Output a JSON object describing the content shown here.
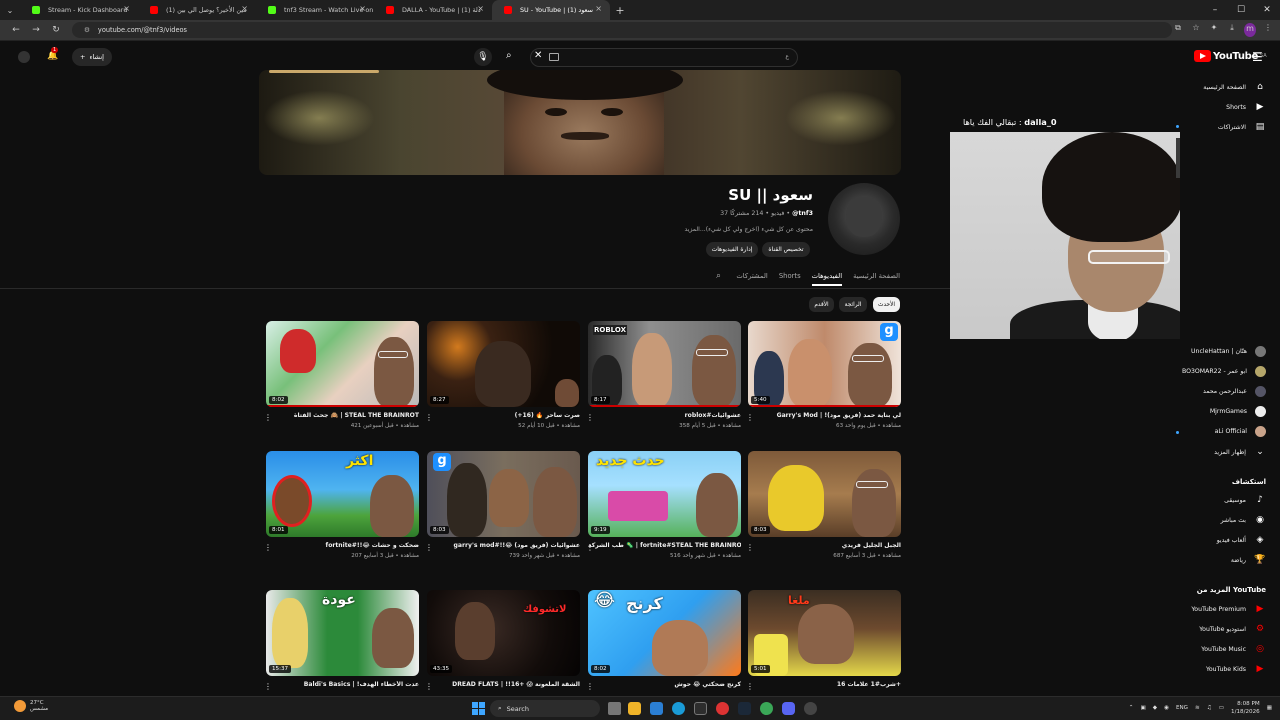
{
  "browser": {
    "tabs": [
      {
        "title": "Stream - Kick Dashboard",
        "favicon_color": "#53fc18",
        "active": false
      },
      {
        "title": "(1) مين الأخير؟ يوصل الي بين",
        "favicon_color": "#ff0000",
        "active": false
      },
      {
        "title": "tnf3 Stream - Watch Live on K",
        "favicon_color": "#53fc18",
        "active": false
      },
      {
        "title": "DALLA - YouTube | دلة (1)",
        "favicon_color": "#ff0000",
        "active": false
      },
      {
        "title": "SU - YouTube | سعود (1)",
        "favicon_color": "#ff0000",
        "active": true
      }
    ],
    "url": "youtube.com/@tnf3/videos"
  },
  "header": {
    "logo_text": "YouTube",
    "logo_region": "SA",
    "create_label": "إنشاء",
    "notification_count": "1",
    "search_lang": "ع"
  },
  "channel": {
    "name": "SU || سعود",
    "handle": "@tnf3",
    "subscribers": "214 مشتركًا",
    "videos_count": "37 فيديو",
    "description": "محتوى عن كل شيء (اخرج ولي كل شيء)...المزيد",
    "btn_customize": "تخصيص القناة",
    "btn_manage": "إدارة الفيديوهات",
    "tabs": [
      "الصفحة الرئيسية",
      "الفيديوهات",
      "Shorts",
      "المشتركات"
    ],
    "active_tab": "الفيديوهات",
    "chips": [
      "الأحدث",
      "الرائجة",
      "الأقدم"
    ]
  },
  "videos": [
    {
      "title": "جحث الفتاة 🙈 | STEAL THE BRAINROT",
      "meta": "421 مشاهدة • قبل أسبوعين",
      "duration": "8:02"
    },
    {
      "title": "صرت ساحر 🔥 (16+)",
      "meta": "52 مشاهدة • قبل 10 أيام",
      "duration": "8:27"
    },
    {
      "title": "roblox#عشوائيات",
      "meta": "358 مشاهدة • قبل 5 أيام",
      "duration": "8:17"
    },
    {
      "title": "Garry's Mod | !(فريق مود) لي بناية حمد",
      "meta": "63 مشاهدة • قبل يوم واحد",
      "duration": "5:40"
    },
    {
      "title": "fortnite#!!😂 ضحكت و حشات",
      "meta": "207 مشاهدة • قبل 3 أسابيع",
      "duration": "8:01"
    },
    {
      "title": "garry's mod#!!😂 (فريق مود) عشوائيات",
      "meta": "739 مشاهدة • قبل شهر واحد",
      "duration": "8:03"
    },
    {
      "title": "طب الشركة 🦠 | fortnite#STEAL THE BRAINROT",
      "meta": "516 مشاهدة • قبل شهر واحد",
      "duration": "9:19"
    },
    {
      "title": "الجبل الجليل فريدي",
      "meta": "687 مشاهدة • قبل 3 أسابيع",
      "duration": "8:03"
    },
    {
      "title": "Baldi's Basics | !عدت الأخطاء الهدف",
      "meta": "",
      "duration": "15:37"
    },
    {
      "title": "DREAD FLATS | !!16+ 😱 الشقة الملعونة",
      "meta": "",
      "duration": "43:35"
    },
    {
      "title": "كرنج ضحكتي 😂 حوش",
      "meta": "",
      "duration": "8:02"
    },
    {
      "title": "شرب#1 علامات 16+",
      "meta": "",
      "duration": "5:01"
    }
  ],
  "sidebar": {
    "main": [
      {
        "label": "الصفحة الرئيسية",
        "icon": "home-icon"
      },
      {
        "label": "Shorts",
        "icon": "shorts-icon"
      },
      {
        "label": "الاشتراكات",
        "icon": "subscriptions-icon"
      }
    ],
    "subs": [
      {
        "label": "UncleHattan | هتّان",
        "color": "#777"
      },
      {
        "label": "BO3OMAR22 - ابو عمر",
        "color": "#b5a66a"
      },
      {
        "label": "عبدالرحمن محمد",
        "color": "#556"
      },
      {
        "label": "MjrmGames",
        "color": "#eee"
      },
      {
        "label": "aLi Official",
        "color": "#c9a38a"
      }
    ],
    "show_more": "إظهار المزيد",
    "explore_title": "استكشاف",
    "explore": [
      {
        "label": "موسيقى",
        "icon": "music-icon"
      },
      {
        "label": "بث مباشر",
        "icon": "live-icon"
      },
      {
        "label": "ألعاب فيديو",
        "icon": "gaming-icon"
      },
      {
        "label": "رياضة",
        "icon": "trophy-icon"
      }
    ],
    "more_title": "المزيد من YouTube",
    "more": [
      {
        "label": "YouTube Premium"
      },
      {
        "label": "YouTube استوديو"
      },
      {
        "label": "YouTube Music"
      },
      {
        "label": "YouTube Kids"
      }
    ]
  },
  "webcam": {
    "caption_user": "dalla_0",
    "caption_text": "تبقالي الفك ياها :"
  },
  "taskbar": {
    "weather_temp": "27°C",
    "weather_desc": "مشمس",
    "search_label": "Search",
    "lang": "ENG",
    "time": "8:08 PM",
    "date": "1/18/2026"
  }
}
